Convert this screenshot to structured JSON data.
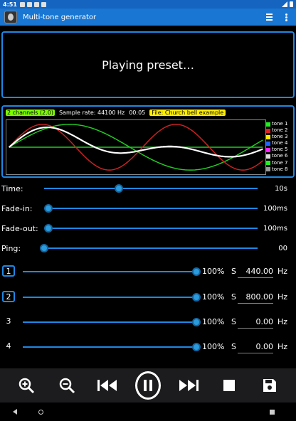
{
  "statusbar": {
    "time": "4:51"
  },
  "app": {
    "title": "Multi-tone generator"
  },
  "message": "Playing preset…",
  "info": {
    "channels": "2 channels (2.0)",
    "sample_rate": "Sample rate: 44100 Hz",
    "elapsed": "00:05",
    "file": "File: Church bell example"
  },
  "legend": [
    {
      "label": "tone 1",
      "color": "#22ee22"
    },
    {
      "label": "tone 2",
      "color": "#dd2222"
    },
    {
      "label": "tone 3",
      "color": "#ffee00"
    },
    {
      "label": "tone 4",
      "color": "#1e66ff"
    },
    {
      "label": "tone 5",
      "color": "#ff22ff"
    },
    {
      "label": "tone 6",
      "color": "#dddddd"
    },
    {
      "label": "tone 7",
      "color": "#22ee22"
    },
    {
      "label": "tone 8",
      "color": "#999999"
    }
  ],
  "controls": {
    "time": {
      "label": "Time:",
      "value": "10s",
      "level": 0.35
    },
    "fadein": {
      "label": "Fade-in:",
      "value": "100ms",
      "level": 0.02
    },
    "fadeout": {
      "label": "Fade-out:",
      "value": "100ms",
      "level": 0.02
    },
    "ping": {
      "label": "Ping:",
      "value": "00",
      "level": 0.0
    }
  },
  "tones": [
    {
      "num": "1",
      "boxed": true,
      "volume": "100%",
      "level": 1.0,
      "s": "S",
      "freq": "440.00",
      "unit": "Hz"
    },
    {
      "num": "2",
      "boxed": true,
      "volume": "100%",
      "level": 1.0,
      "s": "S",
      "freq": "800.00",
      "unit": "Hz"
    },
    {
      "num": "3",
      "boxed": false,
      "volume": "100%",
      "level": 1.0,
      "s": "S",
      "freq": "0.00",
      "unit": "Hz"
    },
    {
      "num": "4",
      "boxed": false,
      "volume": "100%",
      "level": 1.0,
      "s": "S",
      "freq": "0.00",
      "unit": "Hz"
    }
  ],
  "colors": {
    "accent": "#1e88e5",
    "wave_white": "#ffffff",
    "wave_red": "#cc2222",
    "wave_green": "#22cc22"
  }
}
